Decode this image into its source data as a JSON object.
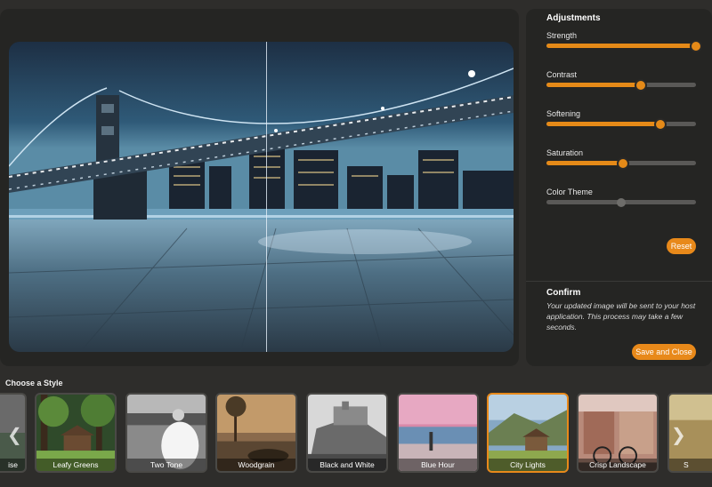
{
  "adjustments": {
    "title": "Adjustments",
    "sliders": [
      {
        "label": "Strength",
        "value": 1.0,
        "active": true
      },
      {
        "label": "Contrast",
        "value": 0.63,
        "active": true
      },
      {
        "label": "Softening",
        "value": 0.76,
        "active": true
      },
      {
        "label": "Saturation",
        "value": 0.51,
        "active": true
      },
      {
        "label": "Color Theme",
        "value": 0.5,
        "active": false
      }
    ],
    "reset_label": "Reset"
  },
  "confirm": {
    "title": "Confirm",
    "text": "Your updated image will be sent to your host application. This process may take a few seconds.",
    "save_label": "Save and Close"
  },
  "styles": {
    "title": "Choose a Style",
    "items": [
      {
        "label": "ise",
        "selected": false
      },
      {
        "label": "Leafy Greens",
        "selected": false
      },
      {
        "label": "Two Tone",
        "selected": false
      },
      {
        "label": "Woodgrain",
        "selected": false
      },
      {
        "label": "Black and White",
        "selected": false
      },
      {
        "label": "Blue Hour",
        "selected": false
      },
      {
        "label": "City Lights",
        "selected": true
      },
      {
        "label": "Crisp Landscape",
        "selected": false
      },
      {
        "label": "S",
        "selected": false
      }
    ]
  },
  "colors": {
    "accent": "#e8891a",
    "panel": "#252523",
    "background": "#2e2d2b"
  }
}
